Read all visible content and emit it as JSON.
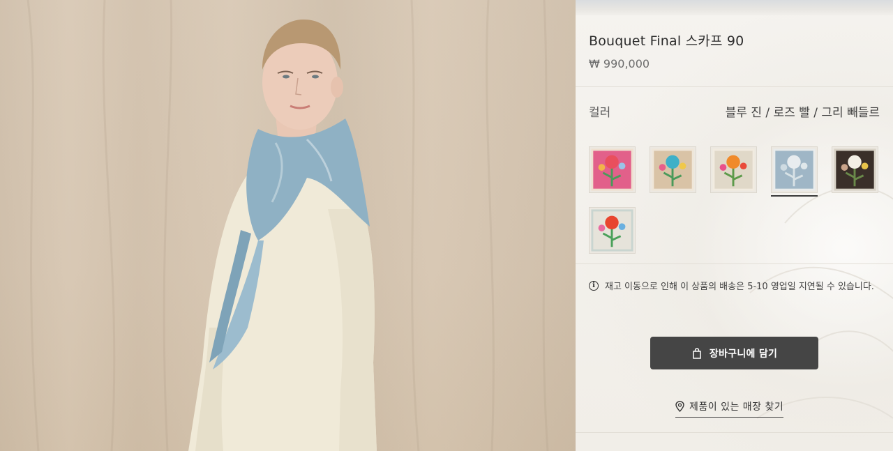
{
  "product": {
    "title": "Bouquet Final 스카프 90",
    "price": "₩ 990,000"
  },
  "color": {
    "label": "컬러",
    "selected_value": "블루 진 / 로즈 빨 / 그리 빼들르",
    "swatches": [
      {
        "name": "pink",
        "bg": "#e2608a",
        "flower": "#e94f5d",
        "selected": false
      },
      {
        "name": "beige-turquoise",
        "bg": "#d9c3a6",
        "flower": "#3fb0c8",
        "selected": false
      },
      {
        "name": "beige-orange",
        "bg": "#e0d8c8",
        "flower": "#f08a2a",
        "selected": false
      },
      {
        "name": "blue",
        "bg": "#9fb6c6",
        "flower": "#e8ecef",
        "selected": true
      },
      {
        "name": "dark",
        "bg": "#3a2f29",
        "flower": "#f3efe5",
        "selected": false
      },
      {
        "name": "light-red",
        "bg": "#e6e3da",
        "flower": "#e8452f",
        "selected": false
      }
    ]
  },
  "notice": {
    "icon": "info-icon",
    "text": "재고 이동으로 인해 이 상품의 배송은 5-10 영업일 지연될 수 있습니다."
  },
  "actions": {
    "cart_label": "장바구니에 담기",
    "cart_icon": "shopping-bag-icon",
    "store_label": "제품이 있는 매장 찾기",
    "store_icon": "location-pin-icon"
  },
  "colors": {
    "button_bg": "#454545",
    "panel_bg": "#f4f1ec"
  }
}
